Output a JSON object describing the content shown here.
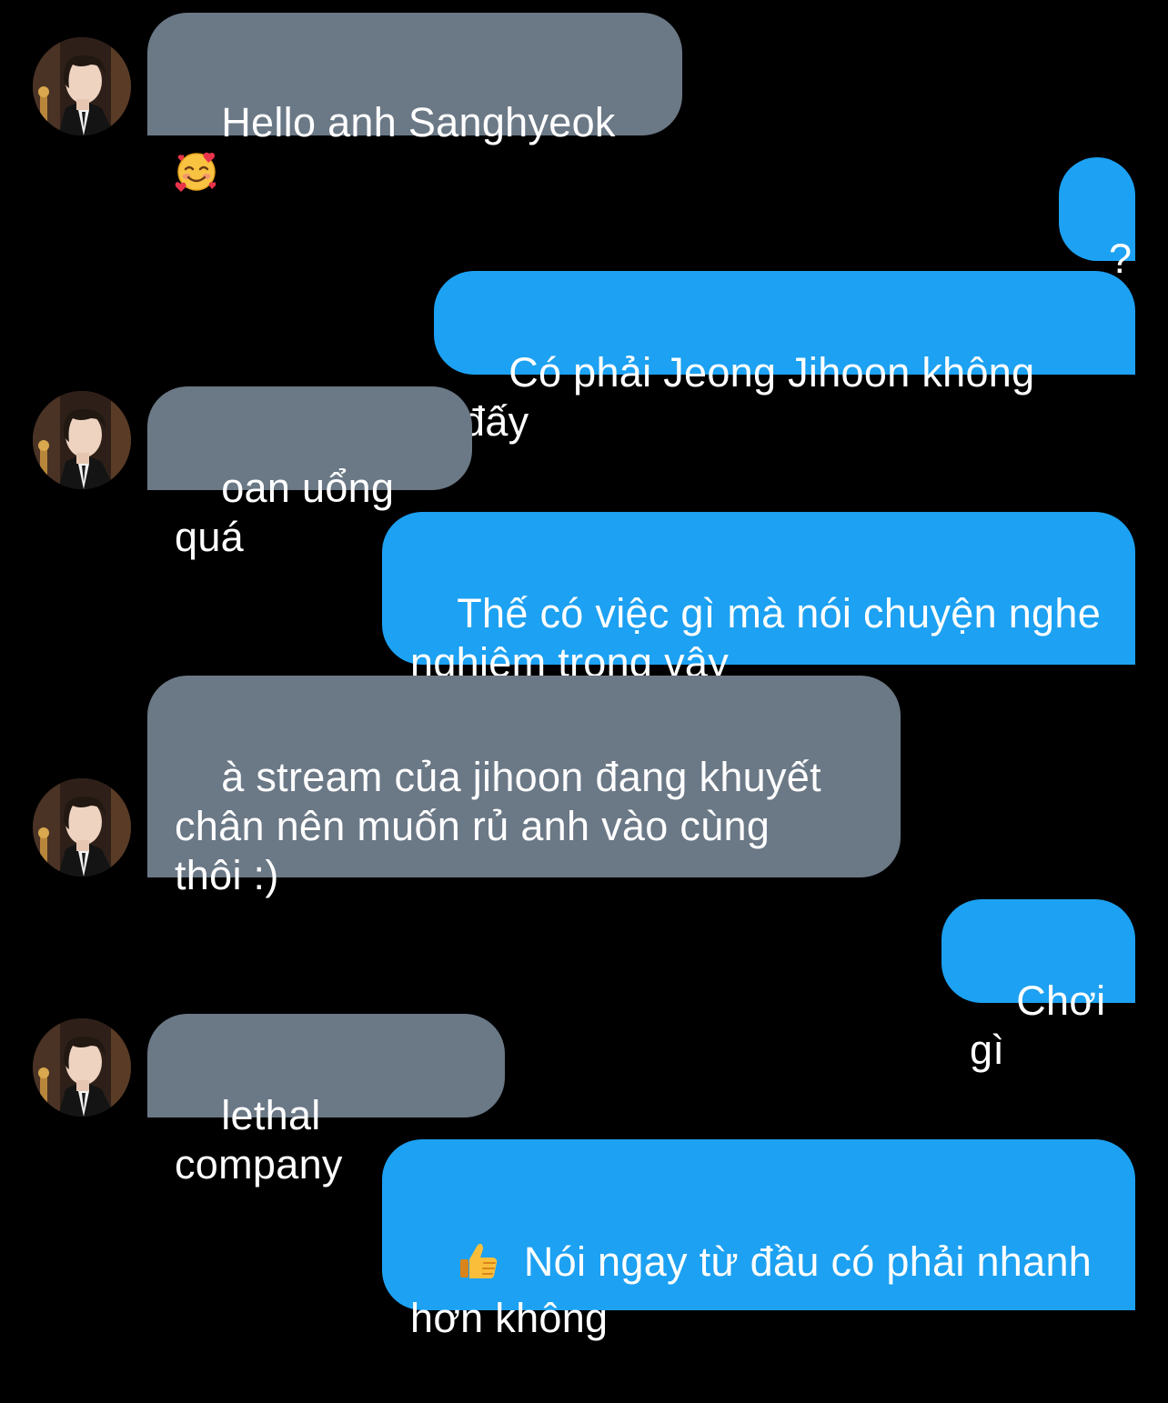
{
  "conversation": {
    "messages": [
      {
        "sender": "other",
        "text": "Hello anh Sanghyeok ",
        "emoji": "smiling-face-with-hearts"
      },
      {
        "sender": "me",
        "text": "?"
      },
      {
        "sender": "me",
        "text": "Có phải Jeong Jihoon không đấy"
      },
      {
        "sender": "other",
        "text": "oan uổng quá"
      },
      {
        "sender": "me",
        "text": "Thế có việc gì mà nói chuyện nghe nghiêm trọng vậy"
      },
      {
        "sender": "other",
        "text": "à stream của jihoon đang khuyết chân nên muốn rủ anh vào cùng thôi :)"
      },
      {
        "sender": "me",
        "text": "Chơi gì"
      },
      {
        "sender": "other",
        "text": "lethal company"
      },
      {
        "sender": "me",
        "text": "Nói ngay từ đầu có phải nhanh hơn không",
        "emoji": "thumbs-up"
      }
    ]
  },
  "colors": {
    "background": "#000000",
    "incoming_bubble": "#6b7886",
    "outgoing_bubble": "#1da1f2",
    "text": "#ffffff"
  }
}
